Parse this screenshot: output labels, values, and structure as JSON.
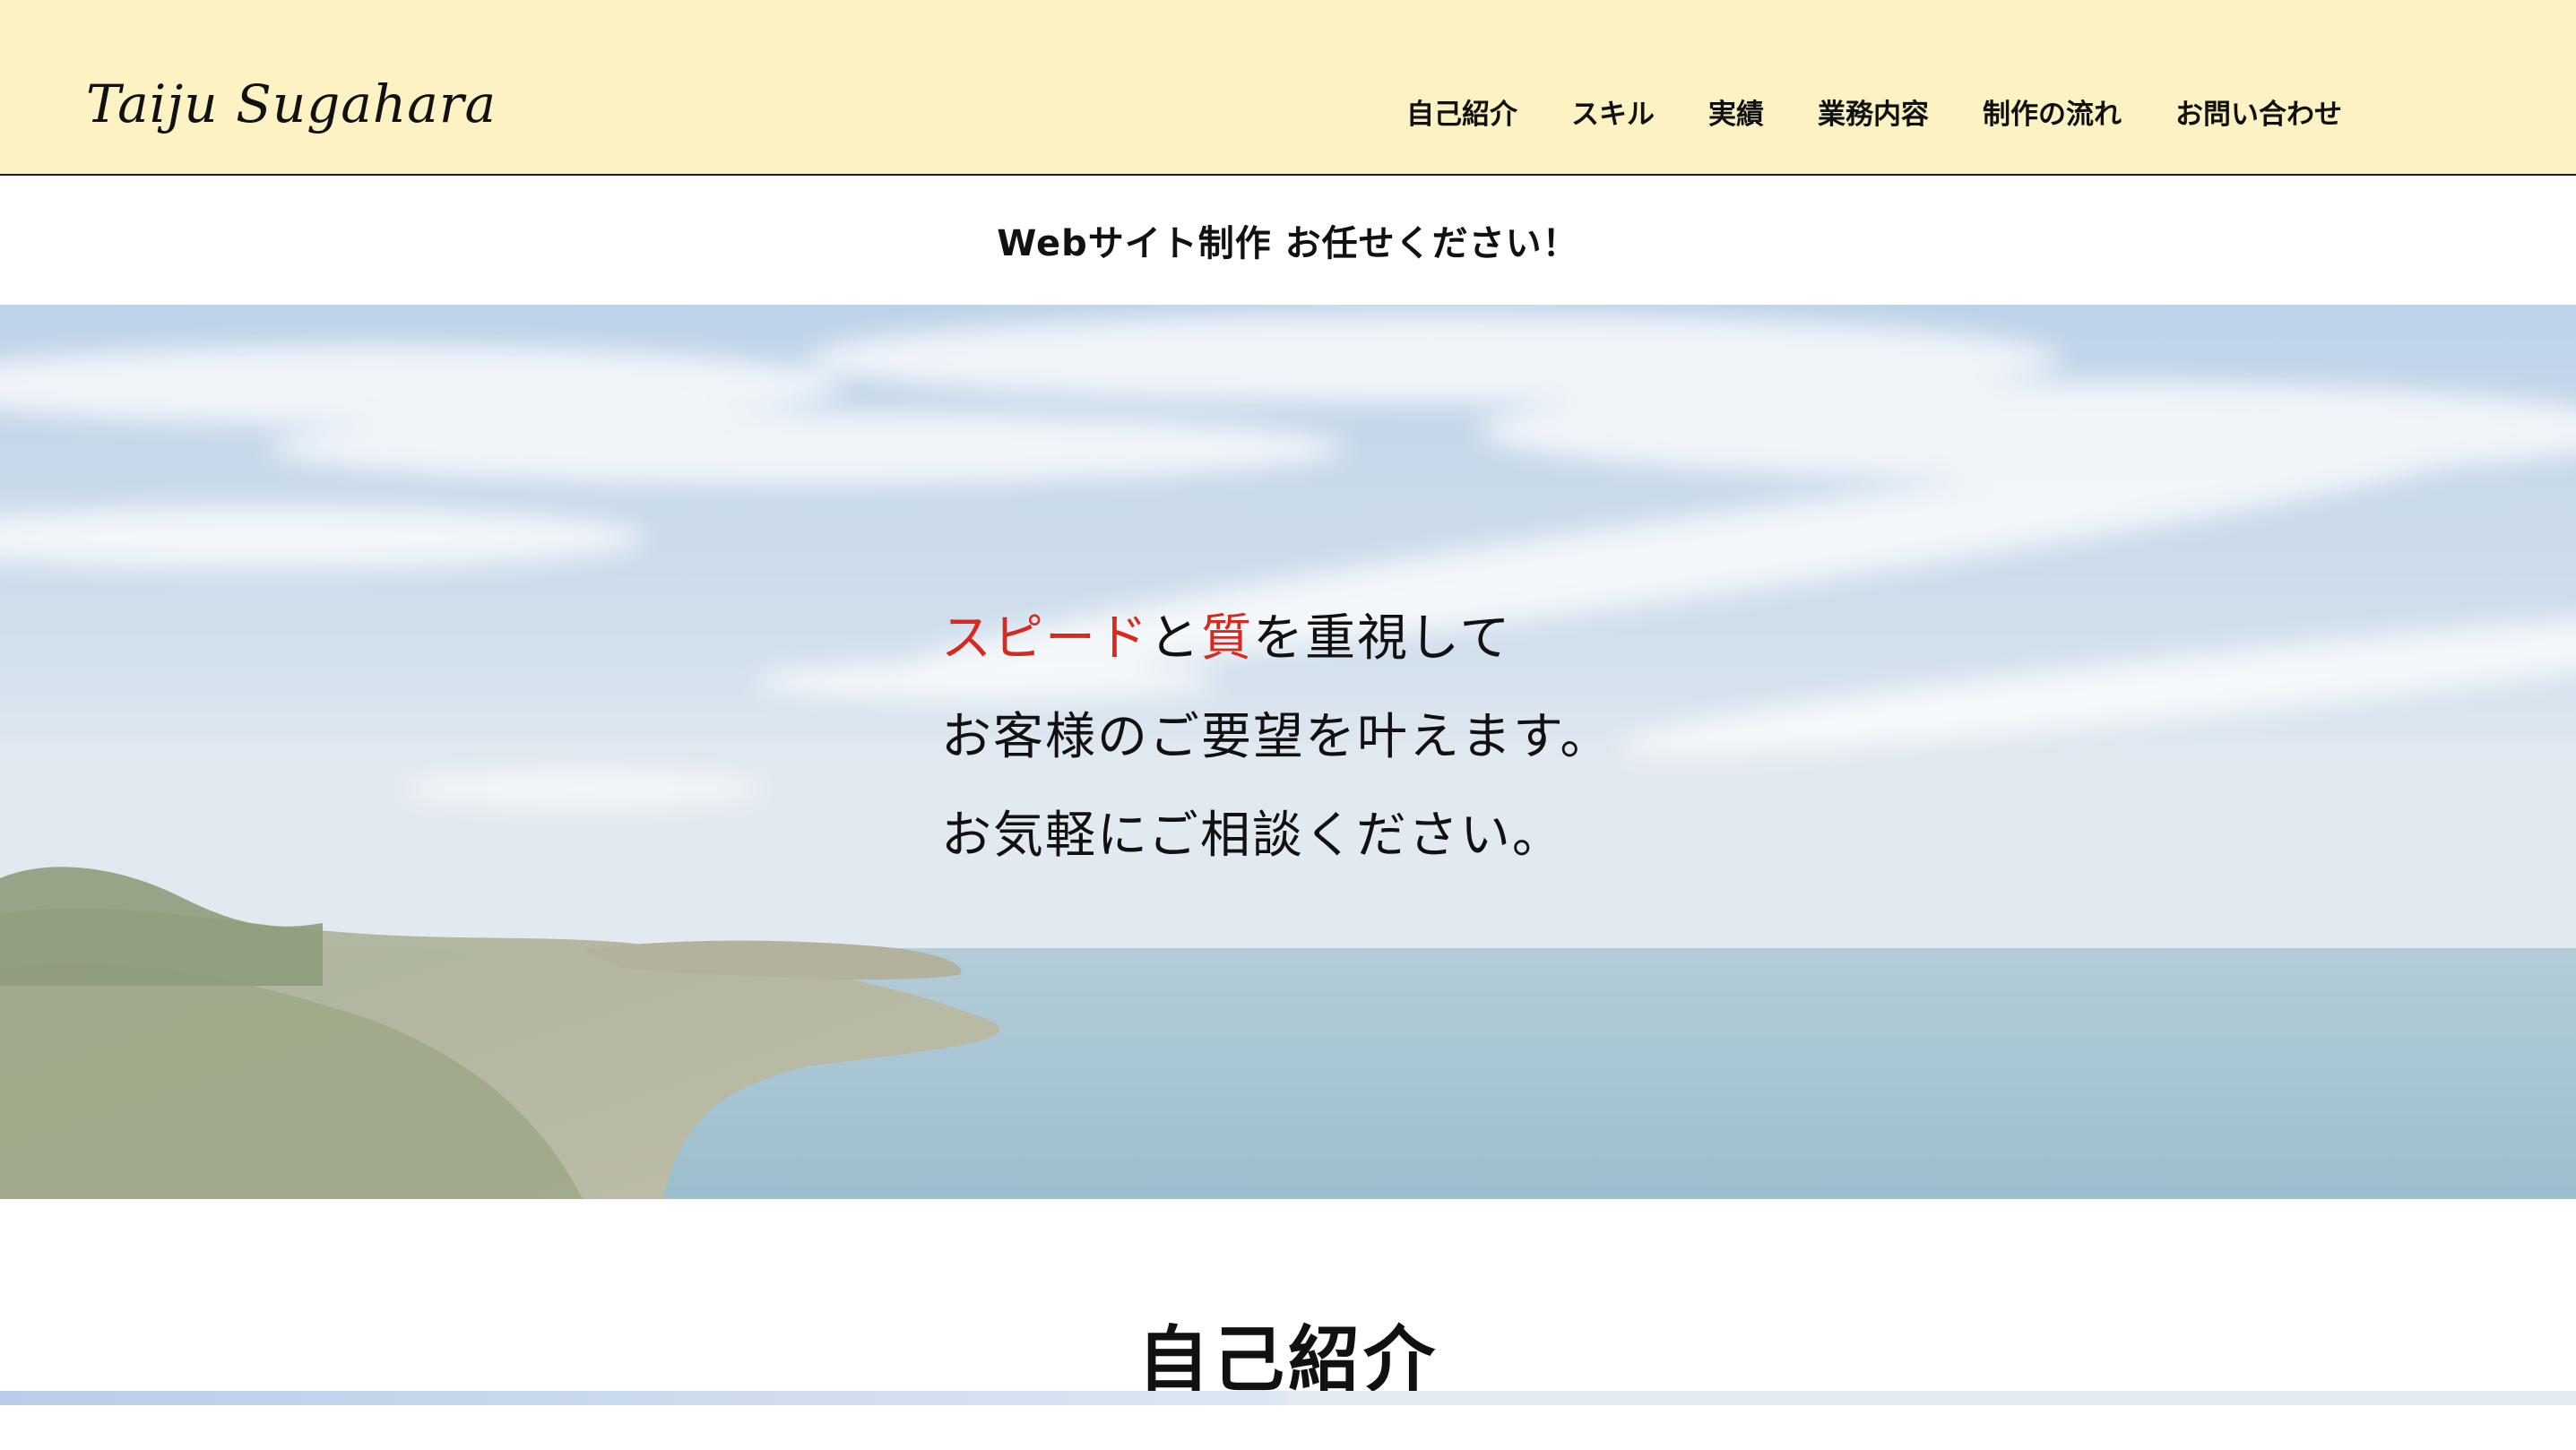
{
  "header": {
    "logo": "Taiju Sugahara",
    "nav": [
      {
        "label": "自己紹介"
      },
      {
        "label": "スキル"
      },
      {
        "label": "実績"
      },
      {
        "label": "業務内容"
      },
      {
        "label": "制作の流れ"
      },
      {
        "label": "お問い合わせ"
      }
    ]
  },
  "tagline": "Webサイト制作 お任せください！",
  "hero": {
    "line1": {
      "accent1": "スピード",
      "mid": "と",
      "accent2": "質",
      "rest": "を重視して"
    },
    "line2": "お客様のご要望を叶えます。",
    "line3": "お気軽にご相談ください。",
    "accent_color": "#d62a1f"
  },
  "section": {
    "title": "自己紹介"
  },
  "colors": {
    "header_bg": "#fdf2c3",
    "text": "#111111"
  }
}
